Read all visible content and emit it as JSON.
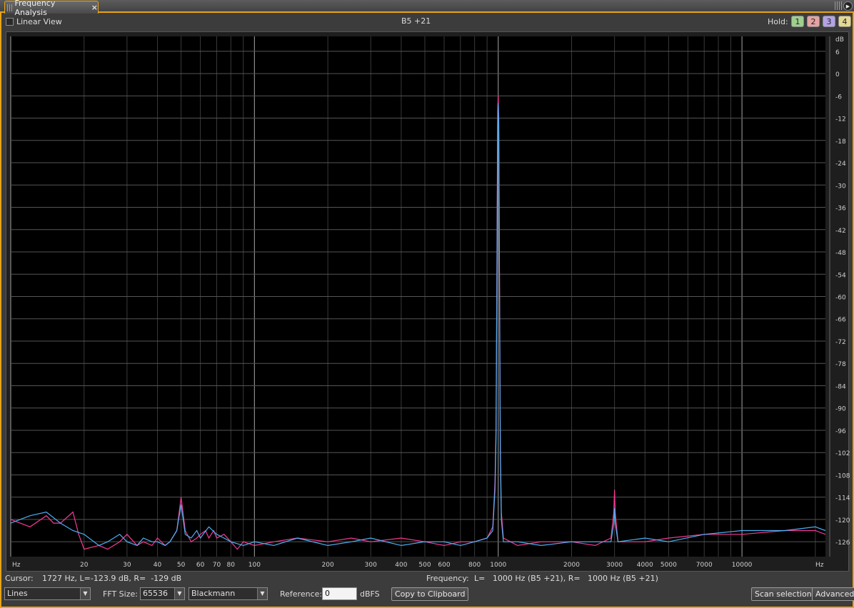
{
  "window": {
    "tab_title": "Frequency Analysis",
    "close_glyph": "×",
    "menu_glyph": "▶"
  },
  "top": {
    "linear_view_label": "Linear View",
    "linear_view_checked": false,
    "note_display": "B5 +21",
    "hold_label": "Hold:",
    "hold_buttons": [
      {
        "label": "1",
        "color": "#9fcf8f"
      },
      {
        "label": "2",
        "color": "#e6a3a3"
      },
      {
        "label": "3",
        "color": "#b3a3e6"
      },
      {
        "label": "4",
        "color": "#e6d98f"
      }
    ]
  },
  "chart_data": {
    "type": "line",
    "x_scale": "log",
    "x_unit_label_left": "Hz",
    "x_unit_label_right": "Hz",
    "y_unit_label": "dB",
    "xlim": [
      10,
      22000
    ],
    "ylim": [
      -130,
      10
    ],
    "x_tick_labels": [
      {
        "value": 20,
        "label": "20"
      },
      {
        "value": 30,
        "label": "30"
      },
      {
        "value": 40,
        "label": "40"
      },
      {
        "value": 50,
        "label": "50"
      },
      {
        "value": 60,
        "label": "60"
      },
      {
        "value": 70,
        "label": "70"
      },
      {
        "value": 80,
        "label": "80"
      },
      {
        "value": 100,
        "label": "100"
      },
      {
        "value": 200,
        "label": "200"
      },
      {
        "value": 300,
        "label": "300"
      },
      {
        "value": 400,
        "label": "400"
      },
      {
        "value": 500,
        "label": "500"
      },
      {
        "value": 600,
        "label": "600"
      },
      {
        "value": 800,
        "label": "800"
      },
      {
        "value": 1000,
        "label": "1000"
      },
      {
        "value": 2000,
        "label": "2000"
      },
      {
        "value": 3000,
        "label": "3000"
      },
      {
        "value": 4000,
        "label": "4000"
      },
      {
        "value": 5000,
        "label": "5000"
      },
      {
        "value": 7000,
        "label": "7000"
      },
      {
        "value": 10000,
        "label": "10000"
      }
    ],
    "y_tick_labels": [
      "6",
      "0",
      "-6",
      "-12",
      "-18",
      "-24",
      "-30",
      "-36",
      "-42",
      "-48",
      "-54",
      "-60",
      "-66",
      "-72",
      "-78",
      "-84",
      "-90",
      "-96",
      "-102",
      "-108",
      "-114",
      "-120",
      "-126"
    ],
    "y_tick_values": [
      6,
      0,
      -6,
      -12,
      -18,
      -24,
      -30,
      -36,
      -42,
      -48,
      -54,
      -60,
      -66,
      -72,
      -78,
      -84,
      -90,
      -96,
      -102,
      -108,
      -114,
      -120,
      -126
    ],
    "series": [
      {
        "color": "#ff3d9a",
        "points": [
          [
            10,
            -120
          ],
          [
            12,
            -122
          ],
          [
            14,
            -119
          ],
          [
            15,
            -121
          ],
          [
            16,
            -121
          ],
          [
            18,
            -118
          ],
          [
            19,
            -124
          ],
          [
            20,
            -128
          ],
          [
            23,
            -127
          ],
          [
            25,
            -128
          ],
          [
            28,
            -126
          ],
          [
            30,
            -124
          ],
          [
            33,
            -127
          ],
          [
            35,
            -126
          ],
          [
            38,
            -127
          ],
          [
            40,
            -125
          ],
          [
            43,
            -127
          ],
          [
            45,
            -126
          ],
          [
            48,
            -123
          ],
          [
            50,
            -114
          ],
          [
            52,
            -123
          ],
          [
            55,
            -126
          ],
          [
            58,
            -125
          ],
          [
            60,
            -124
          ],
          [
            63,
            -123
          ],
          [
            65,
            -125
          ],
          [
            68,
            -123
          ],
          [
            70,
            -125
          ],
          [
            75,
            -124
          ],
          [
            80,
            -126
          ],
          [
            85,
            -128
          ],
          [
            90,
            -126
          ],
          [
            100,
            -127
          ],
          [
            120,
            -126
          ],
          [
            150,
            -125
          ],
          [
            200,
            -126
          ],
          [
            250,
            -125
          ],
          [
            300,
            -126
          ],
          [
            400,
            -125
          ],
          [
            500,
            -126
          ],
          [
            600,
            -127
          ],
          [
            700,
            -126
          ],
          [
            800,
            -126
          ],
          [
            900,
            -125
          ],
          [
            950,
            -122
          ],
          [
            970,
            -110
          ],
          [
            980,
            -95
          ],
          [
            990,
            -40
          ],
          [
            995,
            -10
          ],
          [
            1000,
            -6
          ],
          [
            1005,
            -12
          ],
          [
            1010,
            -40
          ],
          [
            1020,
            -100
          ],
          [
            1030,
            -118
          ],
          [
            1050,
            -125
          ],
          [
            1200,
            -127
          ],
          [
            1500,
            -126
          ],
          [
            2000,
            -126
          ],
          [
            2500,
            -127
          ],
          [
            2900,
            -125
          ],
          [
            2980,
            -118
          ],
          [
            3000,
            -112
          ],
          [
            3020,
            -118
          ],
          [
            3100,
            -126
          ],
          [
            4000,
            -126
          ],
          [
            5000,
            -125
          ],
          [
            7000,
            -124
          ],
          [
            10000,
            -124
          ],
          [
            15000,
            -123
          ],
          [
            20000,
            -123
          ],
          [
            22000,
            -124
          ]
        ]
      },
      {
        "color": "#4fb8ff",
        "points": [
          [
            10,
            -121
          ],
          [
            12,
            -119
          ],
          [
            14,
            -118
          ],
          [
            16,
            -121
          ],
          [
            18,
            -123
          ],
          [
            20,
            -124
          ],
          [
            23,
            -127
          ],
          [
            25,
            -126
          ],
          [
            28,
            -124
          ],
          [
            30,
            -126
          ],
          [
            33,
            -127
          ],
          [
            35,
            -125
          ],
          [
            38,
            -126
          ],
          [
            40,
            -126
          ],
          [
            43,
            -127
          ],
          [
            45,
            -126
          ],
          [
            48,
            -123
          ],
          [
            50,
            -116
          ],
          [
            52,
            -124
          ],
          [
            55,
            -125
          ],
          [
            58,
            -123
          ],
          [
            60,
            -125
          ],
          [
            65,
            -122
          ],
          [
            70,
            -124
          ],
          [
            75,
            -125
          ],
          [
            80,
            -126
          ],
          [
            90,
            -127
          ],
          [
            100,
            -126
          ],
          [
            120,
            -127
          ],
          [
            150,
            -125
          ],
          [
            200,
            -127
          ],
          [
            250,
            -126
          ],
          [
            300,
            -125
          ],
          [
            400,
            -127
          ],
          [
            500,
            -126
          ],
          [
            600,
            -126
          ],
          [
            700,
            -127
          ],
          [
            800,
            -126
          ],
          [
            900,
            -125
          ],
          [
            950,
            -123
          ],
          [
            970,
            -112
          ],
          [
            980,
            -98
          ],
          [
            990,
            -45
          ],
          [
            995,
            -14
          ],
          [
            1000,
            -8
          ],
          [
            1005,
            -15
          ],
          [
            1010,
            -45
          ],
          [
            1020,
            -102
          ],
          [
            1030,
            -120
          ],
          [
            1050,
            -126
          ],
          [
            1200,
            -126
          ],
          [
            1500,
            -127
          ],
          [
            2000,
            -126
          ],
          [
            2500,
            -126
          ],
          [
            2900,
            -126
          ],
          [
            2980,
            -121
          ],
          [
            3000,
            -117
          ],
          [
            3020,
            -121
          ],
          [
            3100,
            -126
          ],
          [
            4000,
            -125
          ],
          [
            5000,
            -126
          ],
          [
            7000,
            -124
          ],
          [
            10000,
            -123
          ],
          [
            15000,
            -123
          ],
          [
            20000,
            -122
          ],
          [
            22000,
            -123
          ]
        ]
      }
    ],
    "grid": true
  },
  "bottom": {
    "cursor_label": "Cursor:",
    "cursor_value": "1727 Hz, L=-123.9 dB, R=  -129 dB",
    "frequency_label": "Frequency:",
    "frequency_value": "L=   1000 Hz (B5 +21), R=   1000 Hz (B5 +21)",
    "display_mode": "Lines",
    "fft_size_label": "FFT Size:",
    "fft_size": "65536",
    "window_function": "Blackmann",
    "reference_label": "Reference:",
    "reference_value": "0",
    "reference_unit": "dBFS",
    "copy_button": "Copy to Clipboard",
    "scan_button": "Scan selection",
    "advanced_button": "Advanced",
    "arrow_glyph": "▼"
  }
}
